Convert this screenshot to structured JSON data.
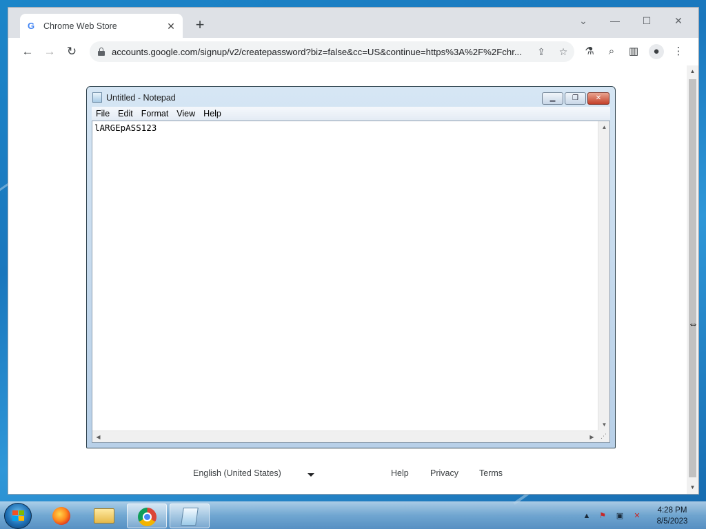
{
  "chrome": {
    "tab": {
      "title": "Chrome Web Store",
      "favicon": "google-g-icon"
    },
    "url": "accounts.google.com/signup/v2/createpassword?biz=false&cc=US&continue=https%3A%2F%2Fchr...",
    "footer": {
      "language": "English (United States)",
      "links": [
        "Help",
        "Privacy",
        "Terms"
      ]
    }
  },
  "notepad": {
    "title": "Untitled - Notepad",
    "menu": [
      "File",
      "Edit",
      "Format",
      "View",
      "Help"
    ],
    "content": "lARGEpASS123"
  },
  "taskbar": {
    "apps": [
      "firefox-icon",
      "file-explorer-icon",
      "chrome-icon",
      "notepad-icon"
    ],
    "clock": {
      "time": "4:28 PM",
      "date": "8/5/2023"
    }
  },
  "colors": {
    "desktop": "#1a77bd",
    "chrome_frame": "#dee1e6",
    "notepad_frame": "#c3d8ec",
    "close_red": "#c4402a"
  }
}
